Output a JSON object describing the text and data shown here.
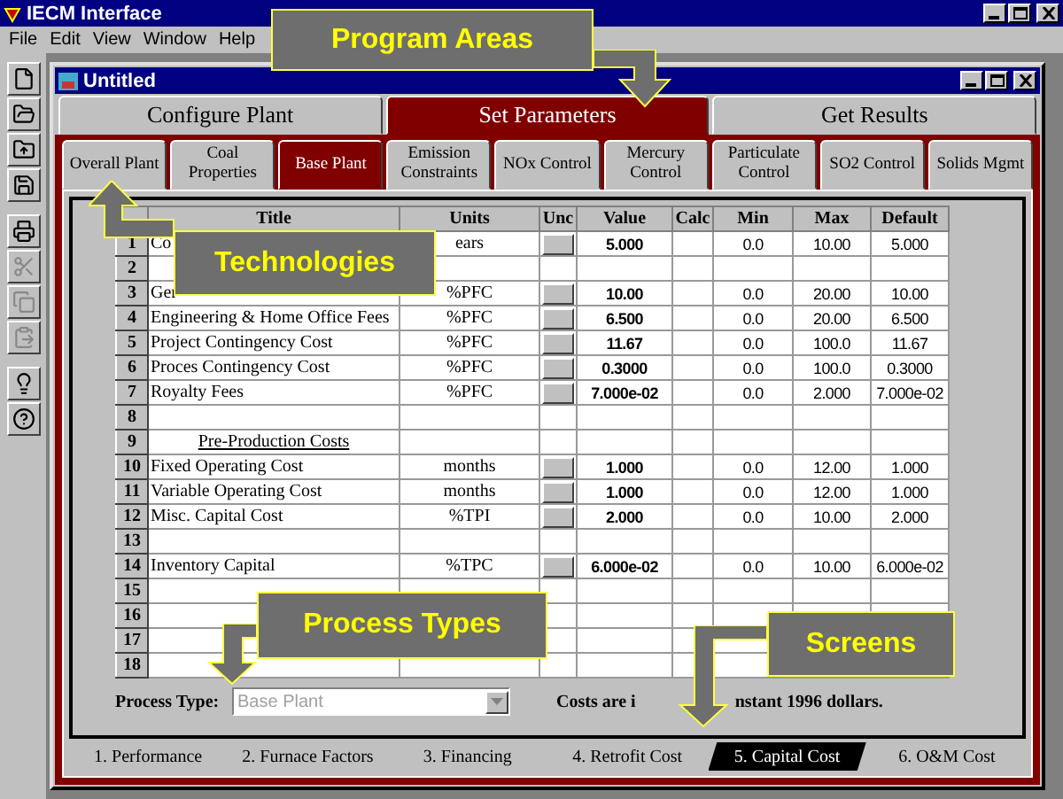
{
  "app_title": "IECM Interface",
  "menu": [
    "File",
    "Edit",
    "View",
    "Window",
    "Help"
  ],
  "toolbar": [
    {
      "kind": "new",
      "disabled": false
    },
    {
      "kind": "open",
      "disabled": false
    },
    {
      "kind": "up",
      "disabled": false
    },
    {
      "kind": "save",
      "disabled": false
    },
    {
      "kind": "print",
      "disabled": false
    },
    {
      "kind": "cut",
      "disabled": true
    },
    {
      "kind": "copy",
      "disabled": true
    },
    {
      "kind": "paste",
      "disabled": true
    },
    {
      "kind": "help",
      "disabled": false
    },
    {
      "kind": "whatsthis",
      "disabled": false
    }
  ],
  "document_title": "Untitled",
  "program_tabs": [
    {
      "label": "Configure Plant",
      "selected": false
    },
    {
      "label": "Set Parameters",
      "selected": true
    },
    {
      "label": "Get Results",
      "selected": false
    }
  ],
  "technology_tabs": [
    {
      "label": "Overall Plant",
      "selected": false
    },
    {
      "label": "Coal Properties",
      "selected": false
    },
    {
      "label": "Base Plant",
      "selected": true
    },
    {
      "label": "Emission Constraints",
      "selected": false
    },
    {
      "label": "NOx Control",
      "selected": false
    },
    {
      "label": "Mercury Control",
      "selected": false
    },
    {
      "label": "Particulate Control",
      "selected": false
    },
    {
      "label": "SO2 Control",
      "selected": false
    },
    {
      "label": "Solids Mgmt",
      "selected": false
    }
  ],
  "table": {
    "columns": [
      "Title",
      "Units",
      "Unc",
      "Value",
      "Calc",
      "Min",
      "Max",
      "Default"
    ],
    "rows": [
      {
        "number": "1",
        "title": "Co",
        "units": "ears",
        "unc": true,
        "value": "5.000",
        "min": "0.0",
        "max": "10.00",
        "default": "5.000"
      },
      {
        "number": "2"
      },
      {
        "number": "3",
        "title": "Ger",
        "units": "%PFC",
        "unc": true,
        "value": "10.00",
        "min": "0.0",
        "max": "20.00",
        "default": "10.00"
      },
      {
        "number": "4",
        "title": "Engineering & Home Office Fees",
        "units": "%PFC",
        "unc": true,
        "value": "6.500",
        "min": "0.0",
        "max": "20.00",
        "default": "6.500"
      },
      {
        "number": "5",
        "title": "Project Contingency Cost",
        "units": "%PFC",
        "unc": true,
        "value": "11.67",
        "min": "0.0",
        "max": "100.0",
        "default": "11.67"
      },
      {
        "number": "6",
        "title": "Proces Contingency Cost",
        "units": "%PFC",
        "unc": true,
        "value": "0.3000",
        "min": "0.0",
        "max": "100.0",
        "default": "0.3000"
      },
      {
        "number": "7",
        "title": "Royalty Fees",
        "units": "%PFC",
        "unc": true,
        "value": "7.000e-02",
        "min": "0.0",
        "max": "2.000",
        "default": "7.000e-02"
      },
      {
        "number": "8"
      },
      {
        "number": "9",
        "title": "Pre-Production Costs",
        "kind": "heading"
      },
      {
        "number": "10",
        "title": "Fixed Operating Cost",
        "units": "months",
        "unc": true,
        "value": "1.000",
        "min": "0.0",
        "max": "12.00",
        "default": "1.000"
      },
      {
        "number": "11",
        "title": "Variable Operating Cost",
        "units": "months",
        "unc": true,
        "value": "1.000",
        "min": "0.0",
        "max": "12.00",
        "default": "1.000"
      },
      {
        "number": "12",
        "title": "Misc. Capital Cost",
        "units": "%TPI",
        "unc": true,
        "value": "2.000",
        "min": "0.0",
        "max": "10.00",
        "default": "2.000"
      },
      {
        "number": "13"
      },
      {
        "number": "14",
        "title": "Inventory Capital",
        "units": "%TPC",
        "unc": true,
        "value": "6.000e-02",
        "min": "0.0",
        "max": "10.00",
        "default": "6.000e-02"
      },
      {
        "number": "15"
      },
      {
        "number": "16"
      },
      {
        "number": "17"
      },
      {
        "number": "18"
      }
    ]
  },
  "process_type": {
    "label": "Process Type:",
    "value": "Base Plant",
    "disabled": true
  },
  "cost_note": [
    "Costs are i",
    "nstant 1996 dollars."
  ],
  "screen_tabs": [
    {
      "label": "1. Performance",
      "selected": false
    },
    {
      "label": "2. Furnace Factors",
      "selected": false
    },
    {
      "label": "3. Financing",
      "selected": false
    },
    {
      "label": "4. Retrofit Cost",
      "selected": false
    },
    {
      "label": "5. Capital Cost",
      "selected": true
    },
    {
      "label": "6. O&M Cost",
      "selected": false
    }
  ],
  "callouts": [
    {
      "label": "Program Areas"
    },
    {
      "label": "Technologies"
    },
    {
      "label": "Process Types"
    },
    {
      "label": "Screens"
    }
  ]
}
